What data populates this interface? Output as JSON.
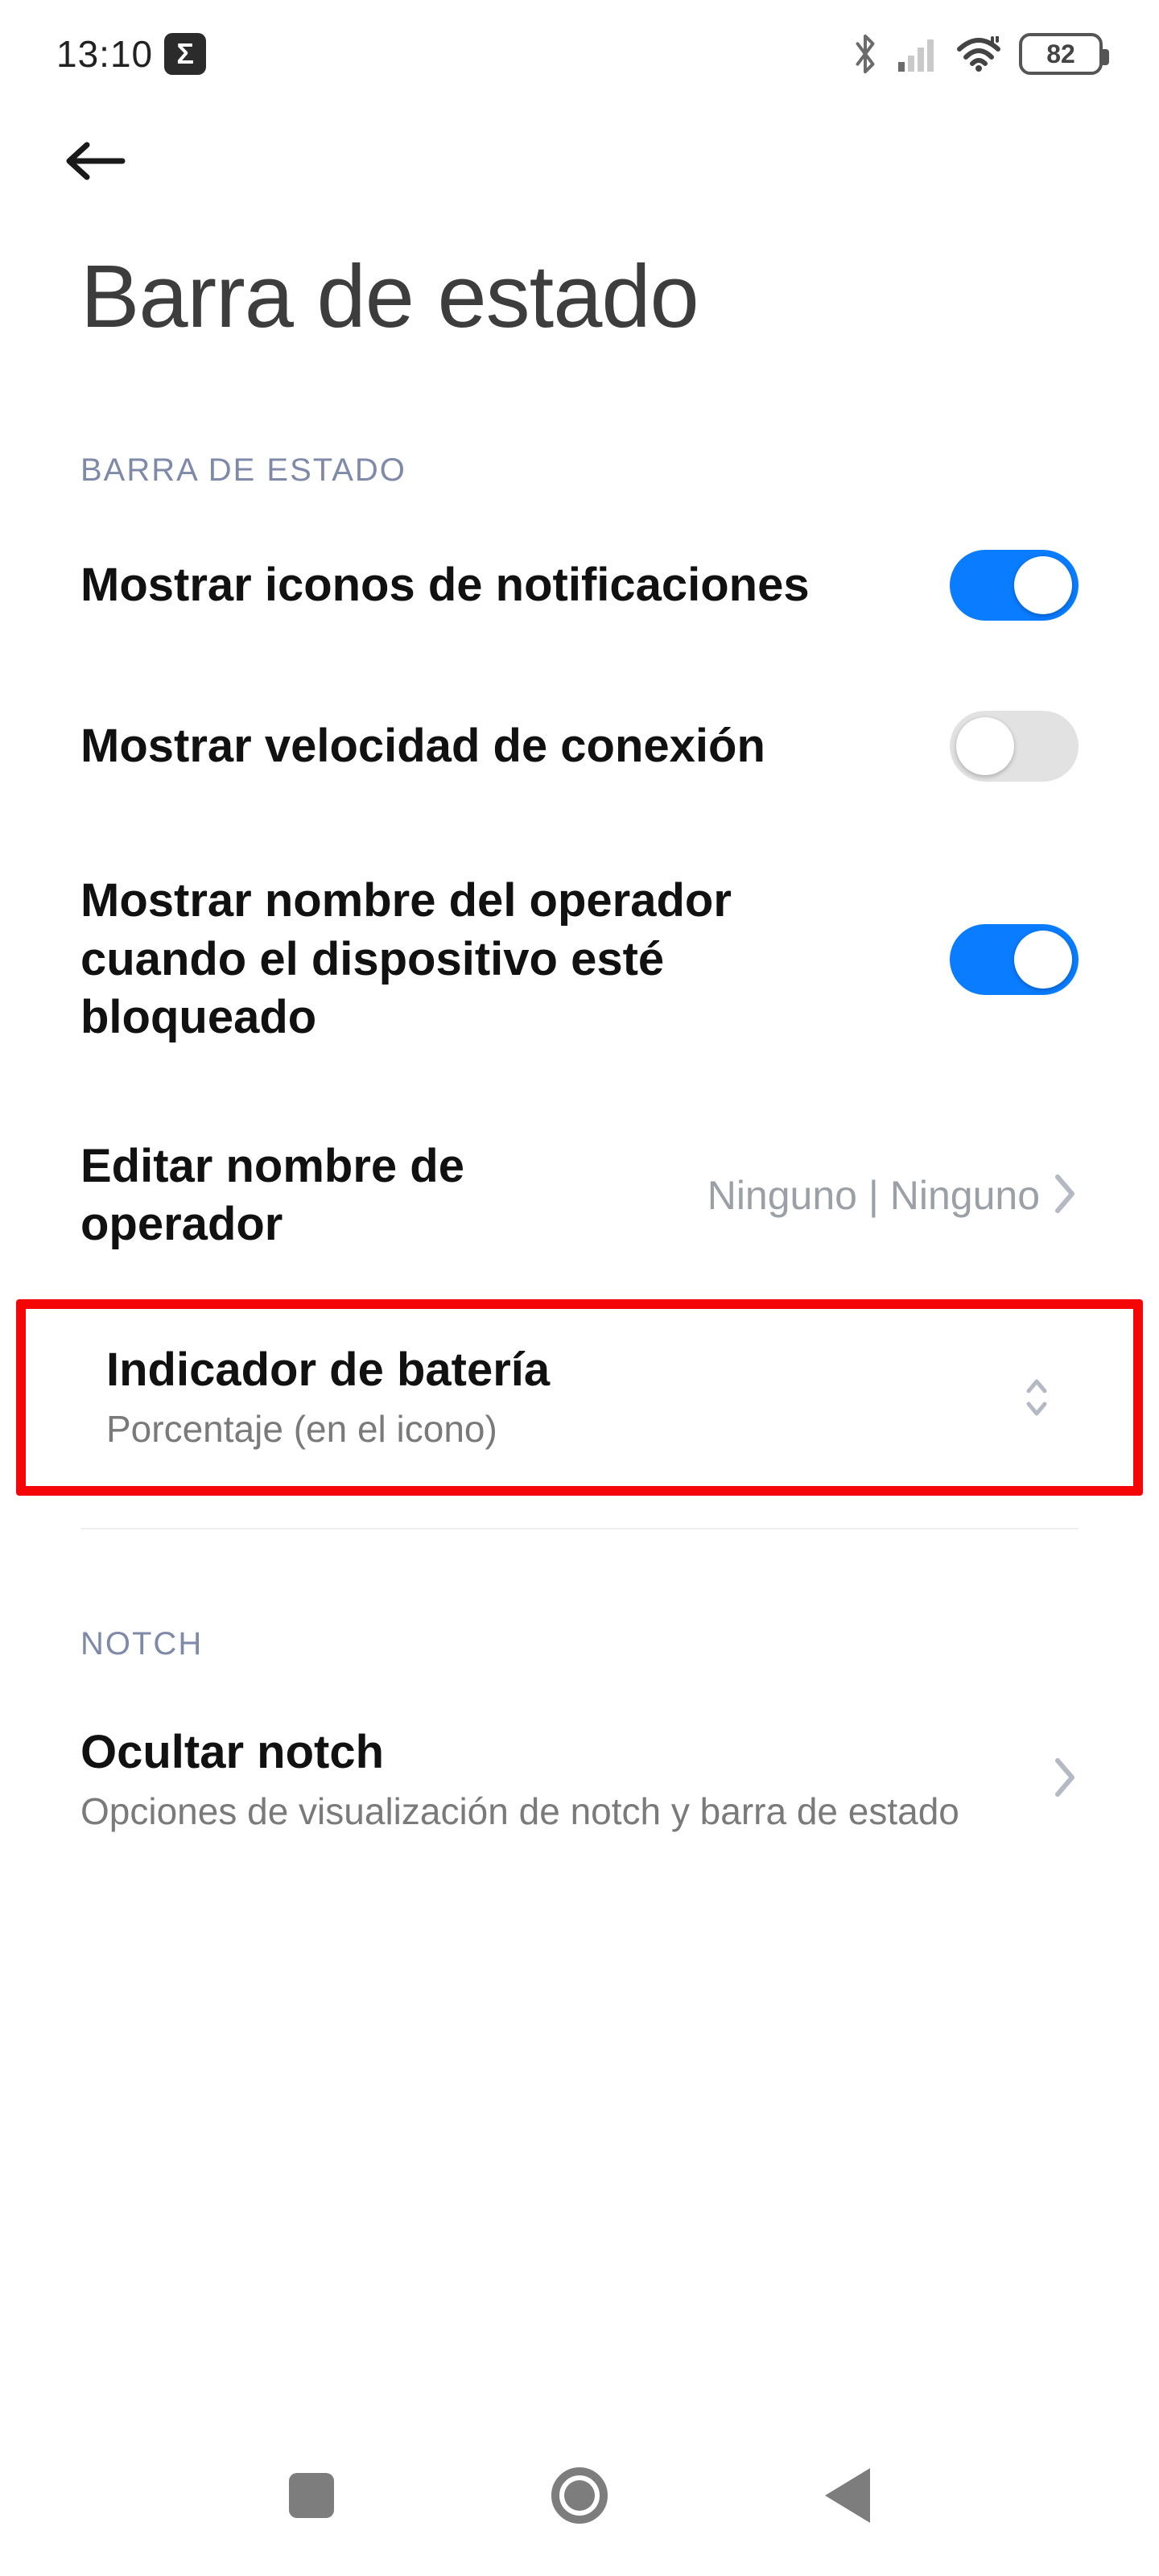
{
  "status": {
    "time": "13:10",
    "app_badge": "Σ",
    "battery_percent": "82"
  },
  "nav": {
    "back": "←"
  },
  "page": {
    "title": "Barra de estado"
  },
  "section1": {
    "header": "BARRA DE ESTADO",
    "items": {
      "notif_icons": {
        "title": "Mostrar iconos de notificaciones",
        "on": true
      },
      "conn_speed": {
        "title": "Mostrar velocidad de conexión",
        "on": false
      },
      "carrier_lock": {
        "title": "Mostrar nombre del operador cuando el dispositivo esté bloqueado",
        "on": true
      },
      "edit_carrier": {
        "title": "Editar nombre de operador",
        "value": "Ninguno | Ninguno"
      },
      "battery_ind": {
        "title": "Indicador de batería",
        "sub": "Porcentaje (en el icono)"
      }
    }
  },
  "section2": {
    "header": "NOTCH",
    "items": {
      "hide_notch": {
        "title": "Ocultar notch",
        "sub": "Opciones de visualización de notch y barra de estado"
      }
    }
  }
}
